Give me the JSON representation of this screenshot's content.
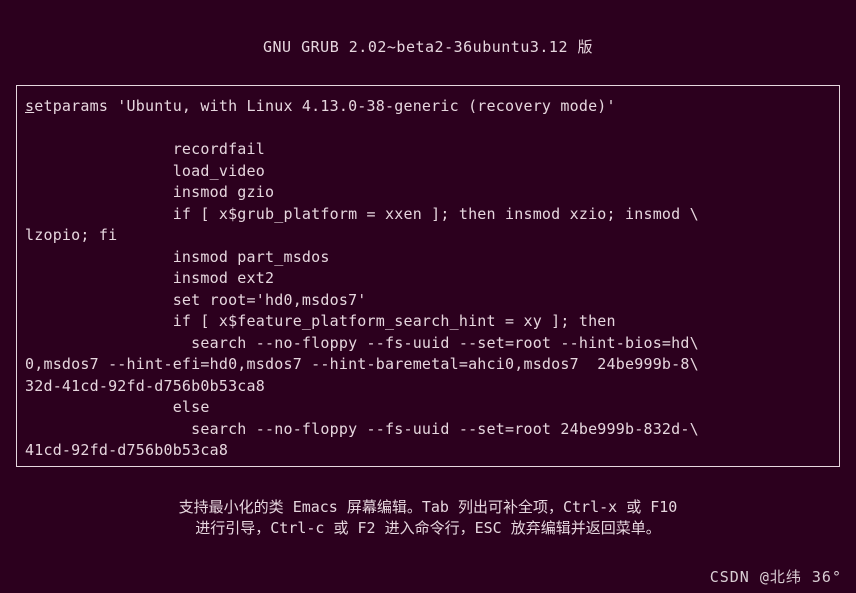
{
  "header": {
    "title": "GNU GRUB  2.02~beta2-36ubuntu3.12 版"
  },
  "editor": {
    "lines": [
      "setparams 'Ubuntu, with Linux 4.13.0-38-generic (recovery mode)'",
      "",
      "                recordfail",
      "                load_video",
      "                insmod gzio",
      "                if [ x$grub_platform = xxen ]; then insmod xzio; insmod \\",
      "lzopio; fi",
      "                insmod part_msdos",
      "                insmod ext2",
      "                set root='hd0,msdos7'",
      "                if [ x$feature_platform_search_hint = xy ]; then",
      "                  search --no-floppy --fs-uuid --set=root --hint-bios=hd\\",
      "0,msdos7 --hint-efi=hd0,msdos7 --hint-baremetal=ahci0,msdos7  24be999b-8\\",
      "32d-41cd-92fd-d756b0b53ca8",
      "                else",
      "                  search --no-floppy --fs-uuid --set=root 24be999b-832d-\\",
      "41cd-92fd-d756b0b53ca8"
    ],
    "scroll_indicator": "↓"
  },
  "help": {
    "line1": "支持最小化的类 Emacs 屏幕编辑。Tab 列出可补全项，Ctrl-x 或 F10",
    "line2": "进行引导，Ctrl-c 或 F2 进入命令行，ESC 放弃编辑并返回菜单。"
  },
  "watermark": "CSDN @北纬  36°"
}
